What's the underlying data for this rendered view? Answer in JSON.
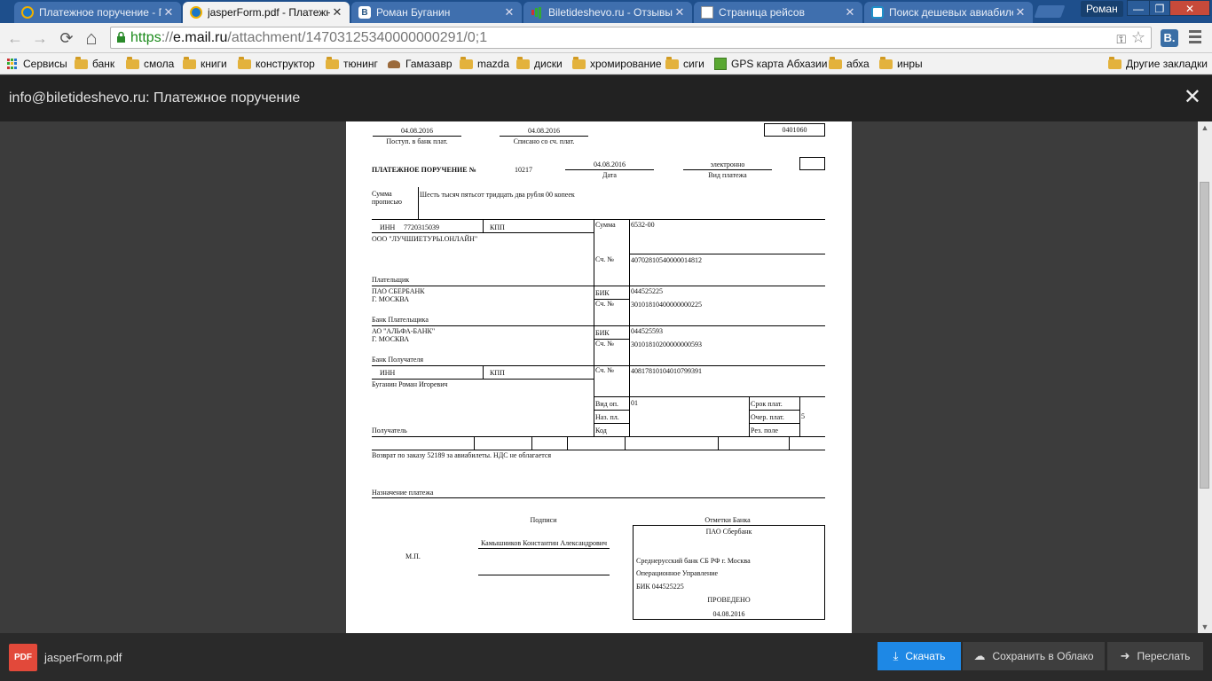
{
  "browser": {
    "tabs": [
      {
        "title": "Платежное поручение - По",
        "icon": "mail-ru-icon"
      },
      {
        "title": "jasperForm.pdf - Платежное",
        "icon": "mail-ru-icon"
      },
      {
        "title": "Роман Буганин",
        "icon": "vk-icon"
      },
      {
        "title": "Biletideshevo.ru - Отзывы о",
        "icon": "bars-icon"
      },
      {
        "title": "Страница рейсов",
        "icon": "page-icon"
      },
      {
        "title": "Поиск дешевых авиабилет",
        "icon": "plane-icon"
      }
    ],
    "close_glyph": "✕",
    "user": "Роман",
    "window_buttons": {
      "minimize": "—",
      "restore": "❐",
      "close": "✕"
    },
    "nav": {
      "back": "←",
      "forward": "→",
      "reload": "⟳",
      "home": "⌂"
    },
    "url": {
      "scheme": "https",
      "sep": "://",
      "host": "e.mail.ru",
      "path": "/attachment/14703125340000000291/0;1"
    },
    "extension_label": "B.",
    "bookmarks": [
      {
        "label": "Сервисы",
        "icon": "apps-icon"
      },
      {
        "label": "банк",
        "icon": "folder-icon"
      },
      {
        "label": "смола",
        "icon": "folder-icon"
      },
      {
        "label": "книги",
        "icon": "folder-icon"
      },
      {
        "label": "конструктор",
        "icon": "folder-icon"
      },
      {
        "label": "тюнинг",
        "icon": "folder-icon"
      },
      {
        "label": "Гамазавр",
        "icon": "gamazavr-icon"
      },
      {
        "label": "mazda",
        "icon": "folder-icon"
      },
      {
        "label": "диски",
        "icon": "folder-icon"
      },
      {
        "label": "хромирование",
        "icon": "folder-icon"
      },
      {
        "label": "сиги",
        "icon": "folder-icon"
      },
      {
        "label": "GPS карта Абхазии",
        "icon": "gps-icon"
      },
      {
        "label": "абха",
        "icon": "folder-icon"
      },
      {
        "label": "инры",
        "icon": "folder-icon"
      }
    ],
    "other_bookmarks": "Другие закладки"
  },
  "viewer": {
    "title": "info@biletideshevo.ru: Платежное поручение",
    "close": "✕",
    "scroll_up": "▲",
    "scroll_down": "▼"
  },
  "doc": {
    "date_received": "04.08.2016",
    "label_received": "Поступ. в банк плат.",
    "date_debited": "04.08.2016",
    "label_debited": "Списано со сч. плат.",
    "form_code": "0401060",
    "title": "ПЛАТЕЖНОЕ ПОРУЧЕНИЕ №",
    "number": "10217",
    "date": "04.08.2016",
    "label_date": "Дата",
    "pay_type": "электронно",
    "label_pay_type": "Вид платежа",
    "label_sum_words_1": "Сумма",
    "label_sum_words_2": "прописью",
    "sum_words": "Шесть тысяч пятьсот тридцать два рубля 00 копеек",
    "label_inn": "ИНН",
    "payer_inn": "7720315039",
    "label_kpp": "КПП",
    "label_sum": "Сумма",
    "sum": "6532-00",
    "payer_name": "ООО \"ЛУЧШИЕТУРЫ.ОНЛАЙН\"",
    "label_account": "Сч. №",
    "payer_account": "40702810540000014812",
    "label_payer": "Плательщик",
    "payer_bank_1": "ПАО СБЕРБАНК",
    "payer_bank_2": "Г. МОСКВА",
    "label_bik": "БИК",
    "payer_bik": "044525225",
    "payer_bank_account": "30101810400000000225",
    "label_payer_bank": "Банк Плательщика",
    "payee_bank_1": "АО \"АЛЬФА-БАНК\"",
    "payee_bank_2": "Г. МОСКВА",
    "payee_bik": "044525593",
    "payee_bank_account": "30101810200000000593",
    "label_payee_bank": "Банк Получателя",
    "payee_account": "40817810104010799391",
    "payee_name": "Буганин Роман Игоревич",
    "label_op_type": "Вид оп.",
    "op_type": "01",
    "label_purpose_code": "Наз. пл.",
    "label_code": "Код",
    "label_term": "Срок плат.",
    "label_order": "Очер. плат.",
    "order": "5",
    "label_reserve": "Рез. поле",
    "label_payee": "Получатель",
    "purpose": "Возврат по заказу 52189 за авиабилеты. НДС не облагается",
    "label_purpose": "Назначение платежа",
    "label_signatures": "Подписи",
    "label_bank_marks": "Отметки Банка",
    "signer": "Камышников Константин Александрович",
    "label_mp": "М.П.",
    "stamp_bank": "ПАО Сбербанк",
    "stamp_branch": "Среднерусский банк СБ РФ г. Москва",
    "stamp_dept": "Операционное Управление",
    "stamp_bik": "БИК 044525225",
    "stamp_status": "ПРОВЕДЕНО",
    "stamp_date": "04.08.2016"
  },
  "footer": {
    "file_type": "PDF",
    "file_name": "jasperForm.pdf",
    "download": "Скачать",
    "save_cloud": "Сохранить в Облако",
    "forward": "Переслать"
  }
}
